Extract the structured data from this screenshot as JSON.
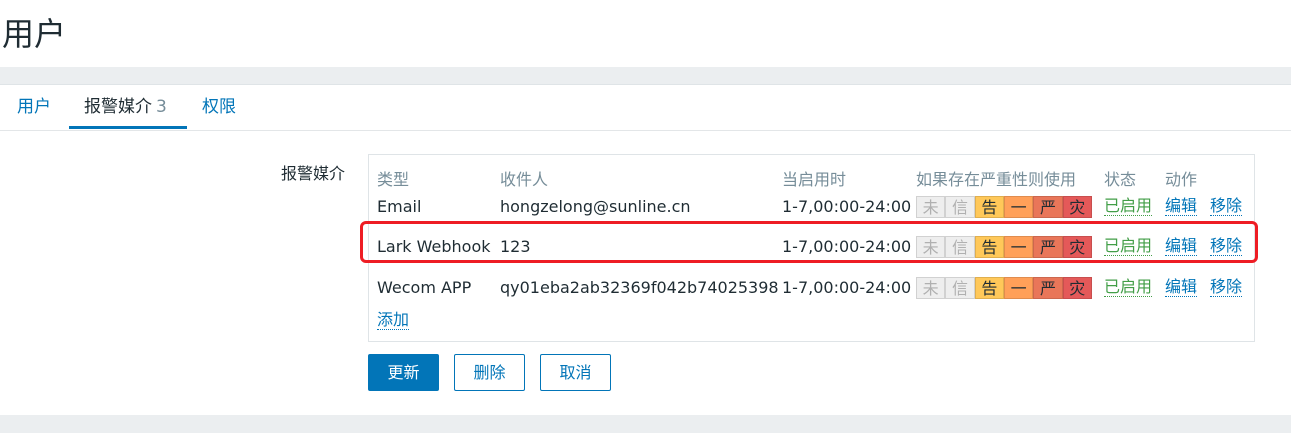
{
  "page": {
    "title": "用户"
  },
  "tabs": [
    {
      "label": "用户",
      "count": ""
    },
    {
      "label": "报警媒介",
      "count": "3"
    },
    {
      "label": "权限",
      "count": ""
    }
  ],
  "media": {
    "field_label": "报警媒介",
    "headers": {
      "type": "类型",
      "sendto": "收件人",
      "when_active": "当启用时",
      "severity": "如果存在严重性则使用",
      "status": "状态",
      "action": "动作"
    },
    "severity_labels": [
      "未",
      "信",
      "告",
      "一",
      "严",
      "灾"
    ],
    "rows": [
      {
        "type": "Email",
        "sendto": "hongzelong@sunline.cn",
        "when": "1-7,00:00-24:00",
        "status": "已启用",
        "edit": "编辑",
        "remove": "移除"
      },
      {
        "type": "Lark Webhook",
        "sendto": "123",
        "when": "1-7,00:00-24:00",
        "status": "已启用",
        "edit": "编辑",
        "remove": "移除"
      },
      {
        "type": "Wecom APP",
        "sendto": "qy01eba2ab32369f042b74025398",
        "when": "1-7,00:00-24:00",
        "status": "已启用",
        "edit": "编辑",
        "remove": "移除"
      }
    ],
    "add_label": "添加"
  },
  "buttons": {
    "update": "更新",
    "delete": "删除",
    "cancel": "取消"
  },
  "colors": {
    "accent": "#0275b8",
    "enabled_green": "#429e47",
    "highlight_red": "#ee1d24",
    "severity": [
      "#eeeeee",
      "#eeeeee",
      "#ffc859",
      "#ffa059",
      "#e97659",
      "#e45959"
    ]
  }
}
